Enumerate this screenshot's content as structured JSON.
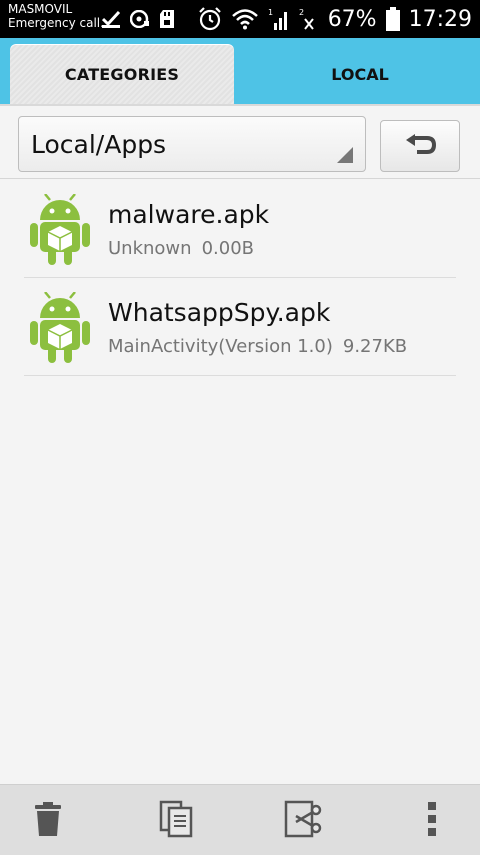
{
  "status_bar": {
    "carrier": "MASMOVIL",
    "emergency": "Emergency call...",
    "battery": "67%",
    "time": "17:29",
    "sim1_label": "1",
    "sim2_label": "2"
  },
  "tabs": [
    {
      "label": "CATEGORIES",
      "active": true
    },
    {
      "label": "LOCAL",
      "active": false
    }
  ],
  "path": {
    "current": "Local/Apps"
  },
  "files": [
    {
      "name": "malware.apk",
      "package": "Unknown",
      "size": "0.00B"
    },
    {
      "name": "WhatsappSpy.apk",
      "package": "MainActivity(Version 1.0)",
      "size": "9.27KB"
    }
  ],
  "colors": {
    "accent": "#4ec3e6",
    "android_green": "#8cbf3f"
  },
  "toolbar_icons": [
    "trash-icon",
    "copy-icon",
    "cut-icon",
    "overflow-menu-icon"
  ]
}
